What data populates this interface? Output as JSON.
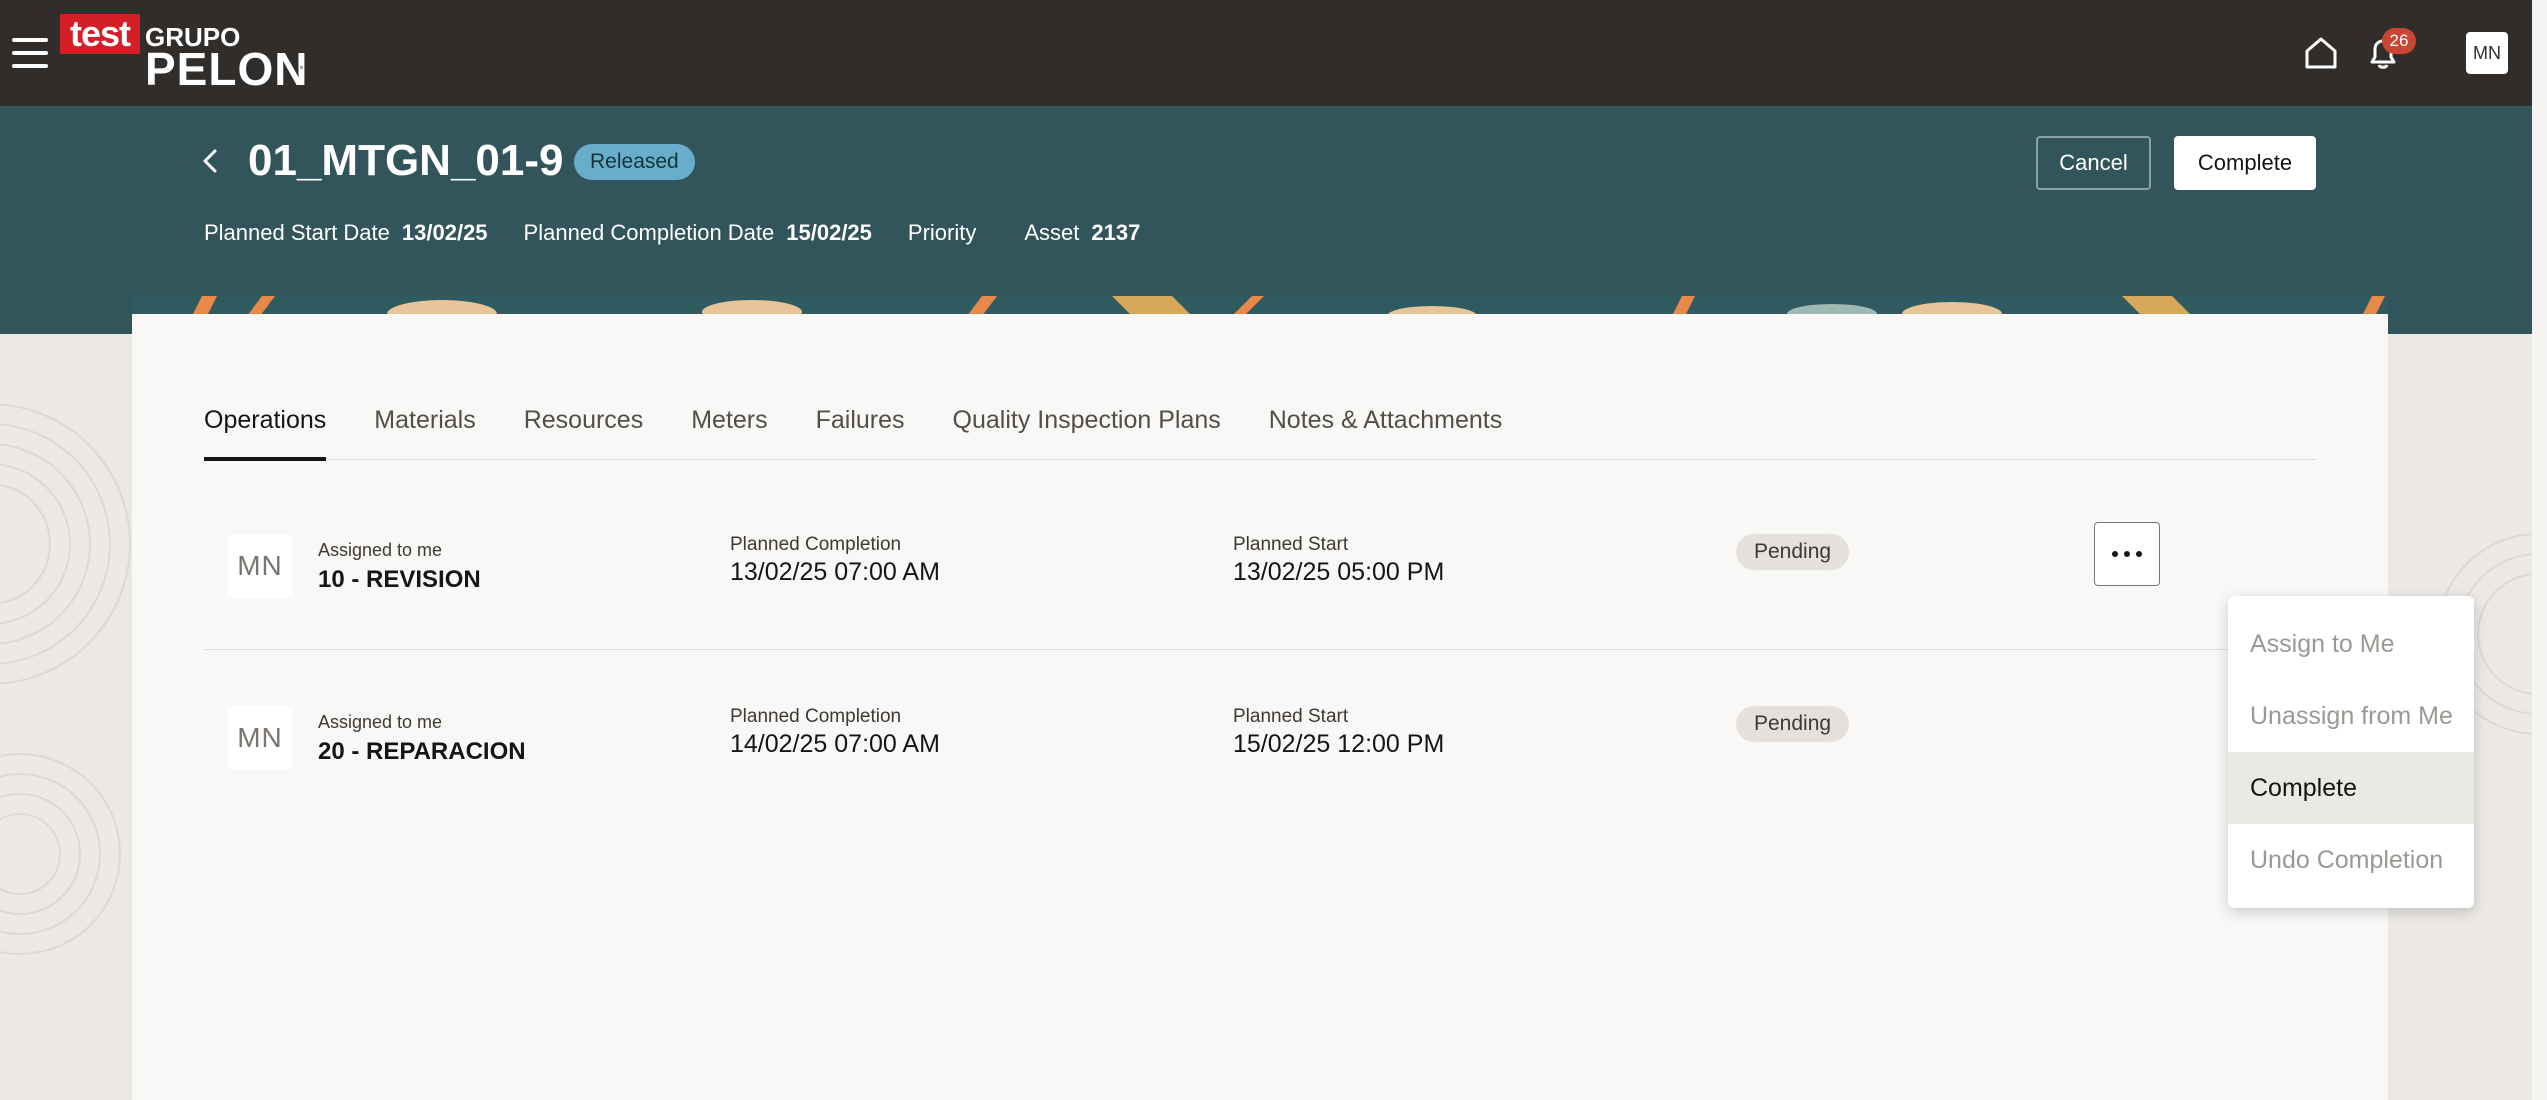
{
  "topbar": {
    "logo_test": "test",
    "logo_grupo": "GRUPO",
    "logo_pelon": "PELON",
    "notifications_count": "26",
    "user_initials": "MN"
  },
  "header": {
    "title": "01_MTGN_01-9",
    "status": "Released",
    "cancel_label": "Cancel",
    "complete_label": "Complete",
    "planned_start_label": "Planned Start Date",
    "planned_start_value": "13/02/25",
    "planned_completion_label": "Planned Completion Date",
    "planned_completion_value": "15/02/25",
    "priority_label": "Priority",
    "asset_label": "Asset",
    "asset_value": "2137"
  },
  "tabs": [
    {
      "label": "Operations",
      "active": true
    },
    {
      "label": "Materials"
    },
    {
      "label": "Resources"
    },
    {
      "label": "Meters"
    },
    {
      "label": "Failures"
    },
    {
      "label": "Quality Inspection Plans"
    },
    {
      "label": "Notes & Attachments"
    }
  ],
  "operations": [
    {
      "initials": "MN",
      "assigned": "Assigned to me",
      "name": "10 - REVISION",
      "planned_completion_label": "Planned Completion",
      "planned_completion": "13/02/25 07:00 AM",
      "planned_start_label": "Planned Start",
      "planned_start": "13/02/25 05:00 PM",
      "status": "Pending"
    },
    {
      "initials": "MN",
      "assigned": "Assigned to me",
      "name": "20 - REPARACION",
      "planned_completion_label": "Planned Completion",
      "planned_completion": "14/02/25 07:00 AM",
      "planned_start_label": "Planned Start",
      "planned_start": "15/02/25 12:00 PM",
      "status": "Pending"
    }
  ],
  "menu": {
    "items": [
      {
        "label": "Assign to Me",
        "enabled": false
      },
      {
        "label": "Unassign from Me",
        "enabled": false
      },
      {
        "label": "Complete",
        "enabled": true
      },
      {
        "label": "Undo Completion",
        "enabled": false
      }
    ]
  },
  "colors": {
    "topbar": "#312d2a",
    "header": "#32545b",
    "status_badge": "#68aecc",
    "notification_badge": "#c74634"
  }
}
